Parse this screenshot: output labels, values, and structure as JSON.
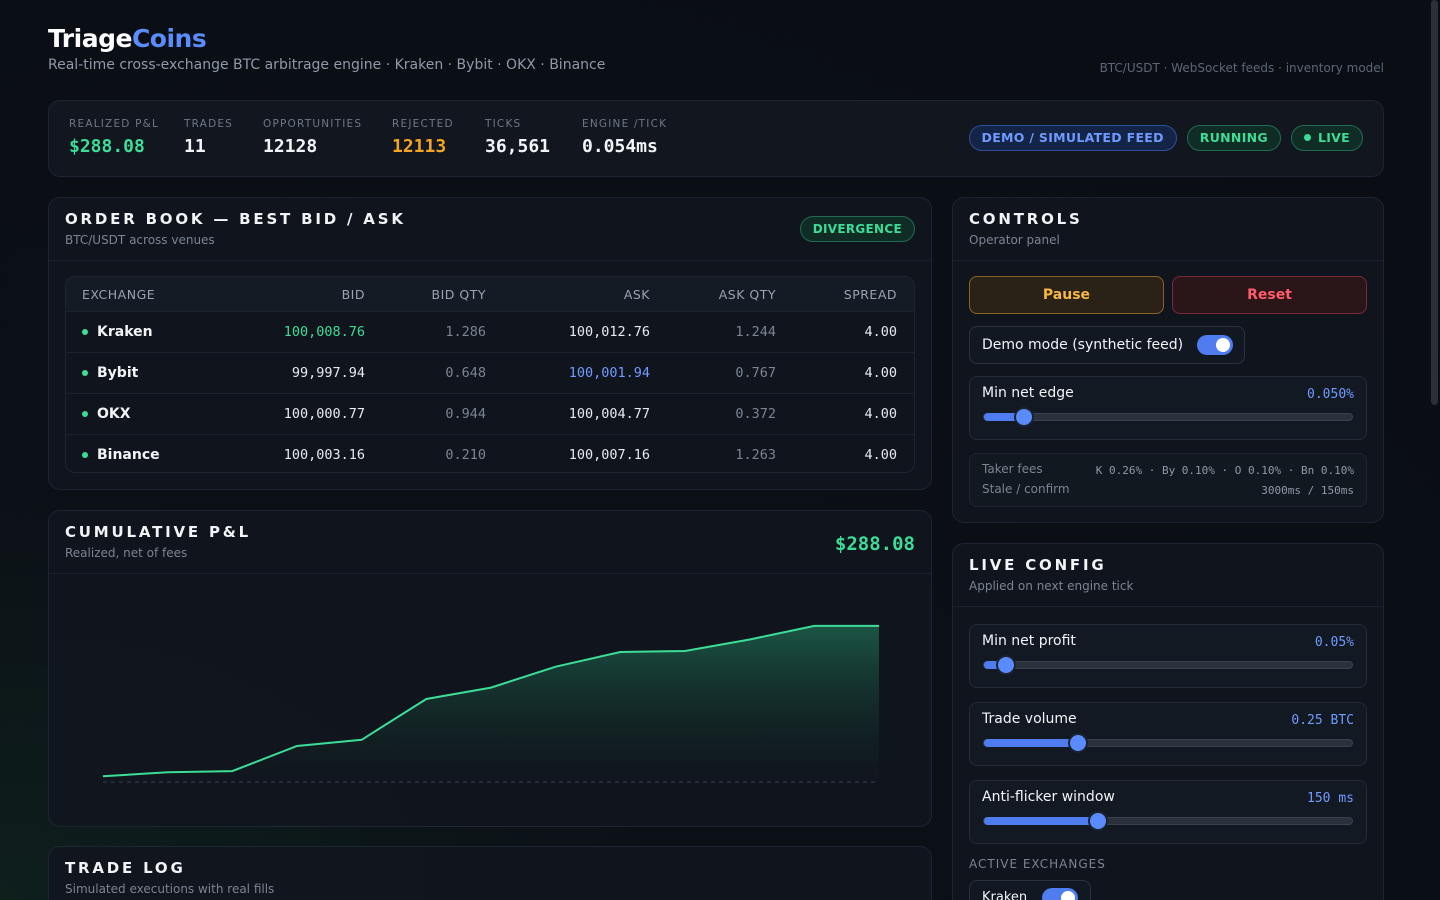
{
  "brand": {
    "name_main": "Triage",
    "name_accent": "Coins",
    "subtitle": "Real-time cross-exchange BTC arbitrage engine · Kraken · Bybit · OKX · Binance",
    "meta": "BTC/USDT · WebSocket feeds · inventory model"
  },
  "stats": [
    {
      "label": "REALIZED P&L",
      "value": "$288.08"
    },
    {
      "label": "TRADES",
      "value": "11"
    },
    {
      "label": "OPPORTUNITIES",
      "value": "12128"
    },
    {
      "label": "REJECTED",
      "value": "12113"
    },
    {
      "label": "TICKS",
      "value": "36,561"
    },
    {
      "label": "ENGINE /TICK",
      "value": "0.054ms"
    }
  ],
  "badges": {
    "demo": "DEMO / SIMULATED FEED",
    "running": "RUNNING",
    "live": "LIVE"
  },
  "orderbook": {
    "title": "ORDER BOOK — BEST BID / ASK",
    "subtitle": "BTC/USDT across venues",
    "badge": "DIVERGENCE",
    "columns": [
      "EXCHANGE",
      "BID",
      "BID QTY",
      "ASK",
      "ASK QTY",
      "SPREAD"
    ],
    "rows": [
      {
        "exchange": "Kraken",
        "bid": "100,008.76",
        "bid_qty": "1.286",
        "ask": "100,012.76",
        "ask_qty": "1.244",
        "spread": "4.00"
      },
      {
        "exchange": "Bybit",
        "bid": "99,997.94",
        "bid_qty": "0.648",
        "ask": "100,001.94",
        "ask_qty": "0.767",
        "spread": "4.00"
      },
      {
        "exchange": "OKX",
        "bid": "100,000.77",
        "bid_qty": "0.944",
        "ask": "100,004.77",
        "ask_qty": "0.372",
        "spread": "4.00"
      },
      {
        "exchange": "Binance",
        "bid": "100,003.16",
        "bid_qty": "0.210",
        "ask": "100,007.16",
        "ask_qty": "1.263",
        "spread": "4.00"
      }
    ],
    "best_bid_row": 0,
    "best_ask_row": 1
  },
  "pnl": {
    "title": "CUMULATIVE P&L",
    "subtitle": "Realized, net of fees",
    "total": "$288.08"
  },
  "chart_data": {
    "type": "area",
    "title": "",
    "xlabel": "",
    "ylabel": "",
    "x": [
      0,
      1,
      2,
      3,
      4,
      5,
      6,
      7,
      8,
      9,
      10,
      11,
      12
    ],
    "series": [
      {
        "values": [
          0,
          8,
          10,
          58,
          70,
          148,
          170,
          210,
          238,
          240,
          262,
          288,
          288
        ]
      }
    ],
    "ylim": [
      -30,
      330
    ],
    "grid": false,
    "color": "#3ddc97"
  },
  "tradelog": {
    "title": "TRADE LOG",
    "subtitle": "Simulated executions with real fills"
  },
  "controls": {
    "title": "CONTROLS",
    "subtitle": "Operator panel",
    "pause_label": "Pause",
    "reset_label": "Reset",
    "demo_toggle_label": "Demo mode (synthetic feed)",
    "demo_toggle_on": true,
    "min_edge": {
      "label": "Min net edge",
      "value_text": "0.050%",
      "fraction": 0.11
    },
    "taker_fees": {
      "label": "Taker fees",
      "value": "K 0.26% · By 0.10% · O 0.10% · Bn 0.10%"
    },
    "stale_confirm": {
      "label": "Stale / confirm",
      "value": "3000ms / 150ms"
    }
  },
  "live_config": {
    "title": "LIVE CONFIG",
    "subtitle": "Applied on next engine tick",
    "sliders": [
      {
        "label": "Min net profit",
        "value_text": "0.05%",
        "fraction": 0.06
      },
      {
        "label": "Trade volume",
        "value_text": "0.25 BTC",
        "fraction": 0.255
      },
      {
        "label": "Anti-flicker window",
        "value_text": "150 ms",
        "fraction": 0.31
      }
    ],
    "active_exchanges_label": "ACTIVE EXCHANGES",
    "exchange_toggles": [
      {
        "label": "Kraken",
        "on": true
      }
    ]
  },
  "colors": {
    "accent": "#5b8cff",
    "positive": "#3ddc97",
    "warning": "#f5a524",
    "danger": "#ff5d6c"
  }
}
